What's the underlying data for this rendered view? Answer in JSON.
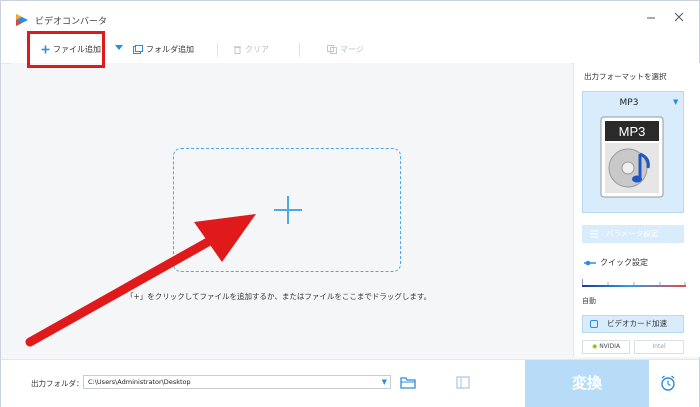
{
  "window": {
    "title": "ビデオコンバータ",
    "minimize_icon": "minimize-icon",
    "close_icon": "close-icon"
  },
  "toolbar": {
    "add_file_label": "ファイル追加",
    "add_folder_label": "フォルダ追加",
    "clear_label": "クリア",
    "merge_label": "マージ"
  },
  "main": {
    "hint": "「+」をクリックしてファイルを追加するか、またはファイルをここまでドラッグします。"
  },
  "right_panel": {
    "title": "出力フォーマットを選択",
    "format": "MP3",
    "format_badge": "MP3",
    "param_settings": "パラメータ設定",
    "quick_settings": "クイック設定",
    "auto_label": "自動",
    "gpu_accel": "ビデオカード加速",
    "vendors": [
      "NVIDIA",
      "Intel"
    ]
  },
  "bottom": {
    "output_folder_label": "出力フォルダ：",
    "output_path": "C:\\Users\\Administrator\\Desktop",
    "convert_label": "変換"
  },
  "colors": {
    "accent": "#2b8de0",
    "highlight": "#e0191b",
    "arrow": "#e0191b",
    "convert_bg": "#b8dcf8"
  }
}
